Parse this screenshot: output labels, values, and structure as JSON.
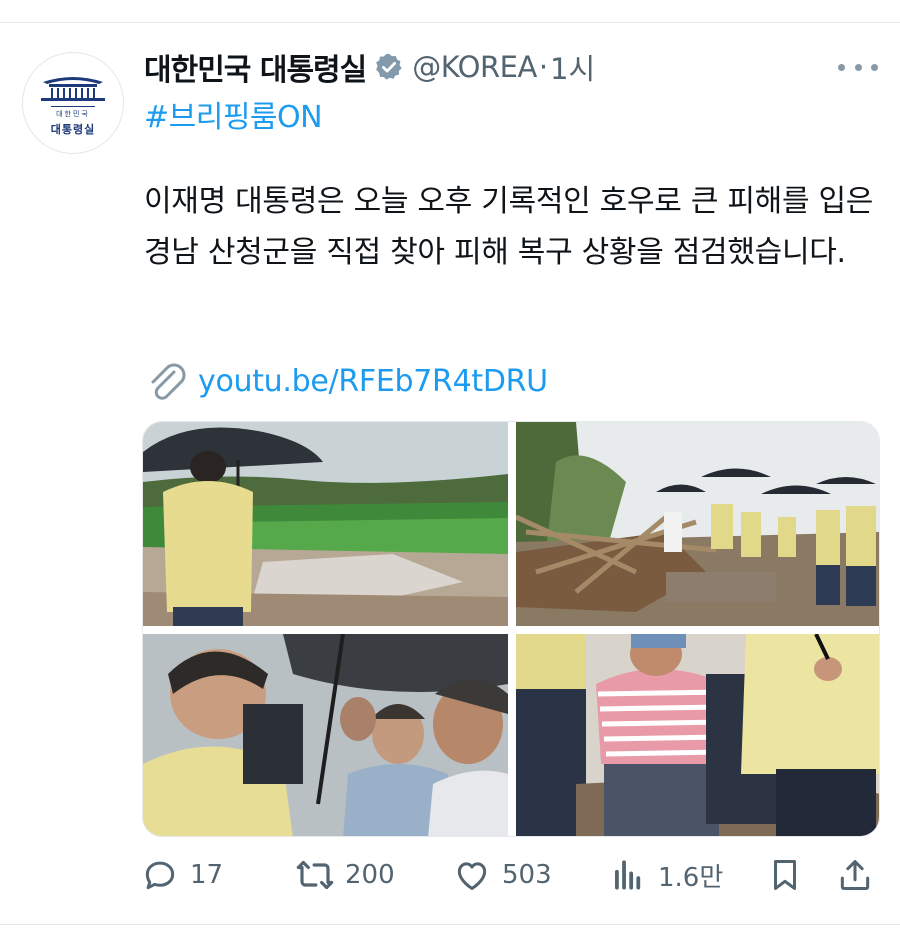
{
  "account": {
    "display_name": "대한민국 대통령실",
    "handle": "@KOREA",
    "separator": "·",
    "time": "1시",
    "avatar_text": "대통령실",
    "avatar_small_text": "대한민국"
  },
  "tweet": {
    "hashtag": "#브리핑룸ON",
    "text": "이재명 대통령은 오늘 오후 기록적인 호우로 큰 피해를 입은 경남 산청군을 직접 찾아 피해 복구 상황을 점검했습니다.",
    "link": "youtu.be/RFEb7R4tDRU"
  },
  "icons": {
    "verified": "verified-badge-icon",
    "more": "more-icon",
    "link": "paperclip-icon",
    "reply": "reply-icon",
    "retweet": "retweet-icon",
    "like": "heart-icon",
    "views": "views-icon",
    "bookmark": "bookmark-icon",
    "share": "share-icon"
  },
  "metrics": {
    "replies": "17",
    "retweets": "200",
    "likes": "503",
    "views": "1.6만"
  },
  "colors": {
    "link_blue": "#1d9bf0",
    "text_primary": "#0f1419",
    "text_secondary": "#536471"
  }
}
